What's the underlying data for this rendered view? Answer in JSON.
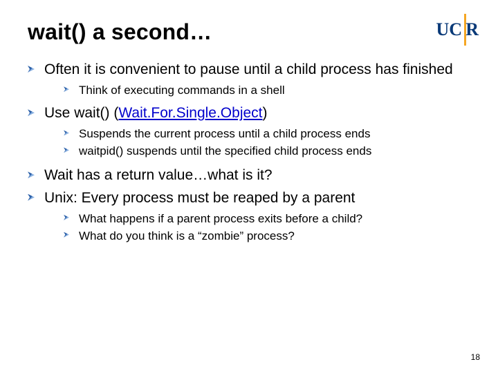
{
  "title": "wait() a second…",
  "logo": {
    "uc": "UC",
    "r": "R"
  },
  "page_number": "18",
  "bullets": {
    "b1": "Often it is convenient to pause until a child process has finished",
    "b1_1": "Think of executing commands in a shell",
    "b2_pre": "Use ",
    "b2_wait": "wait()",
    "b2_mid": " (",
    "b2_link": "Wait.For.Single.Object",
    "b2_post": ")",
    "b2_1": "Suspends the current process until a child process ends",
    "b2_2": "waitpid() suspends until the specified child process ends",
    "b3": "Wait has a return value…what is it?",
    "b4": "Unix: Every process must be reaped by a parent",
    "b4_1": "What happens if a parent process exits before a child?",
    "b4_2": "What do you think is a “zombie” process?"
  }
}
